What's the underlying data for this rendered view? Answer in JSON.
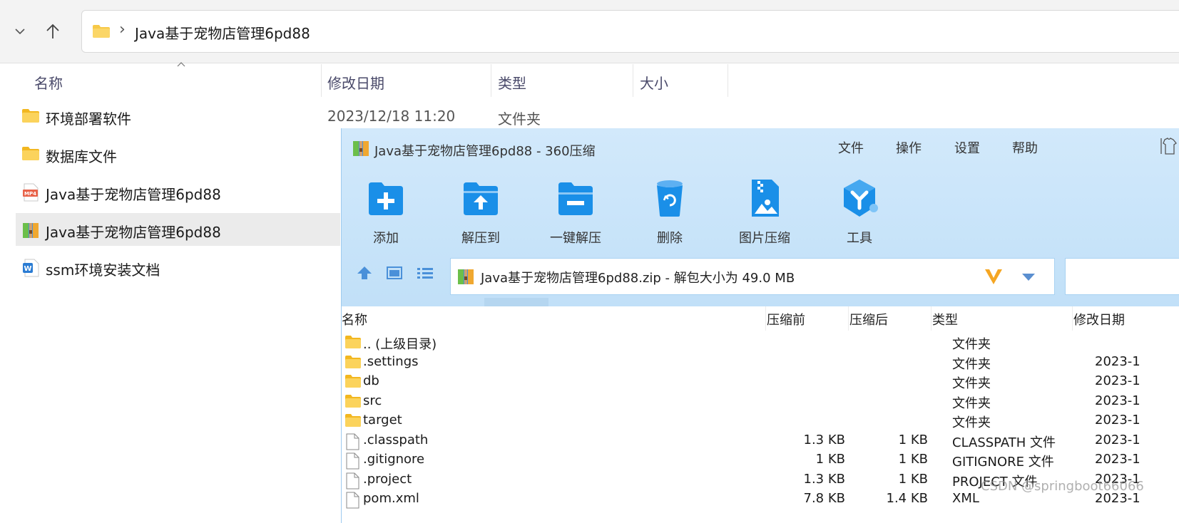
{
  "explorer": {
    "address": {
      "separator": "›",
      "path": "Java基于宠物店管理6pd88"
    },
    "columns": {
      "name": "名称",
      "modified": "修改日期",
      "type": "类型",
      "size": "大小"
    },
    "items": [
      {
        "name": "环境部署软件",
        "icon": "folder-icon",
        "date": "2023/12/18 11:20",
        "type": "文件夹"
      },
      {
        "name": "数据库文件",
        "icon": "folder-icon"
      },
      {
        "name": "Java基于宠物店管理6pd88",
        "icon": "mp4-file-icon"
      },
      {
        "name": "Java基于宠物店管理6pd88",
        "icon": "zip-archive-icon",
        "selected": true
      },
      {
        "name": "ssm环境安装文档",
        "icon": "word-doc-icon"
      }
    ]
  },
  "zip": {
    "title": "Java基于宠物店管理6pd88 - 360压缩",
    "menu": [
      "文件",
      "操作",
      "设置",
      "帮助"
    ],
    "tools": [
      {
        "label": "添加",
        "icon": "add-icon"
      },
      {
        "label": "解压到",
        "icon": "extract-to-icon"
      },
      {
        "label": "一键解压",
        "icon": "one-click-extract-icon"
      },
      {
        "label": "删除",
        "icon": "delete-icon"
      },
      {
        "label": "图片压缩",
        "icon": "image-compress-icon"
      },
      {
        "label": "工具",
        "icon": "tools-icon"
      }
    ],
    "path_text": "Java基于宠物店管理6pd88.zip - 解包大小为 49.0 MB",
    "columns": {
      "name": "名称",
      "before": "压缩前",
      "after": "压缩后",
      "type": "类型",
      "modified": "修改日期"
    },
    "rows": [
      {
        "name": ".. (上级目录)",
        "icon": "folder-icon",
        "before": "",
        "after": "",
        "type": "文件夹",
        "date": ""
      },
      {
        "name": ".settings",
        "icon": "folder-icon",
        "before": "",
        "after": "",
        "type": "文件夹",
        "date": "2023-1"
      },
      {
        "name": "db",
        "icon": "folder-icon",
        "before": "",
        "after": "",
        "type": "文件夹",
        "date": "2023-1"
      },
      {
        "name": "src",
        "icon": "folder-icon",
        "before": "",
        "after": "",
        "type": "文件夹",
        "date": "2023-1"
      },
      {
        "name": "target",
        "icon": "folder-icon",
        "before": "",
        "after": "",
        "type": "文件夹",
        "date": "2023-1"
      },
      {
        "name": ".classpath",
        "icon": "file-icon",
        "before": "1.3 KB",
        "after": "1 KB",
        "type": "CLASSPATH 文件",
        "date": "2023-1"
      },
      {
        "name": ".gitignore",
        "icon": "file-icon",
        "before": "1 KB",
        "after": "1 KB",
        "type": "GITIGNORE 文件",
        "date": "2023-1"
      },
      {
        "name": ".project",
        "icon": "file-icon",
        "before": "1.3 KB",
        "after": "1 KB",
        "type": "PROJECT 文件",
        "date": "2023-1"
      },
      {
        "name": "pom.xml",
        "icon": "file-icon",
        "before": "7.8 KB",
        "after": "1.4 KB",
        "type": "XML",
        "date": "2023-1"
      }
    ],
    "watermark": "CSDN @springboot66066"
  },
  "colors": {
    "zip_header_bg": "#c9e4f9",
    "folder_yellow": "#f7c948",
    "tool_blue": "#1a8fe8"
  }
}
